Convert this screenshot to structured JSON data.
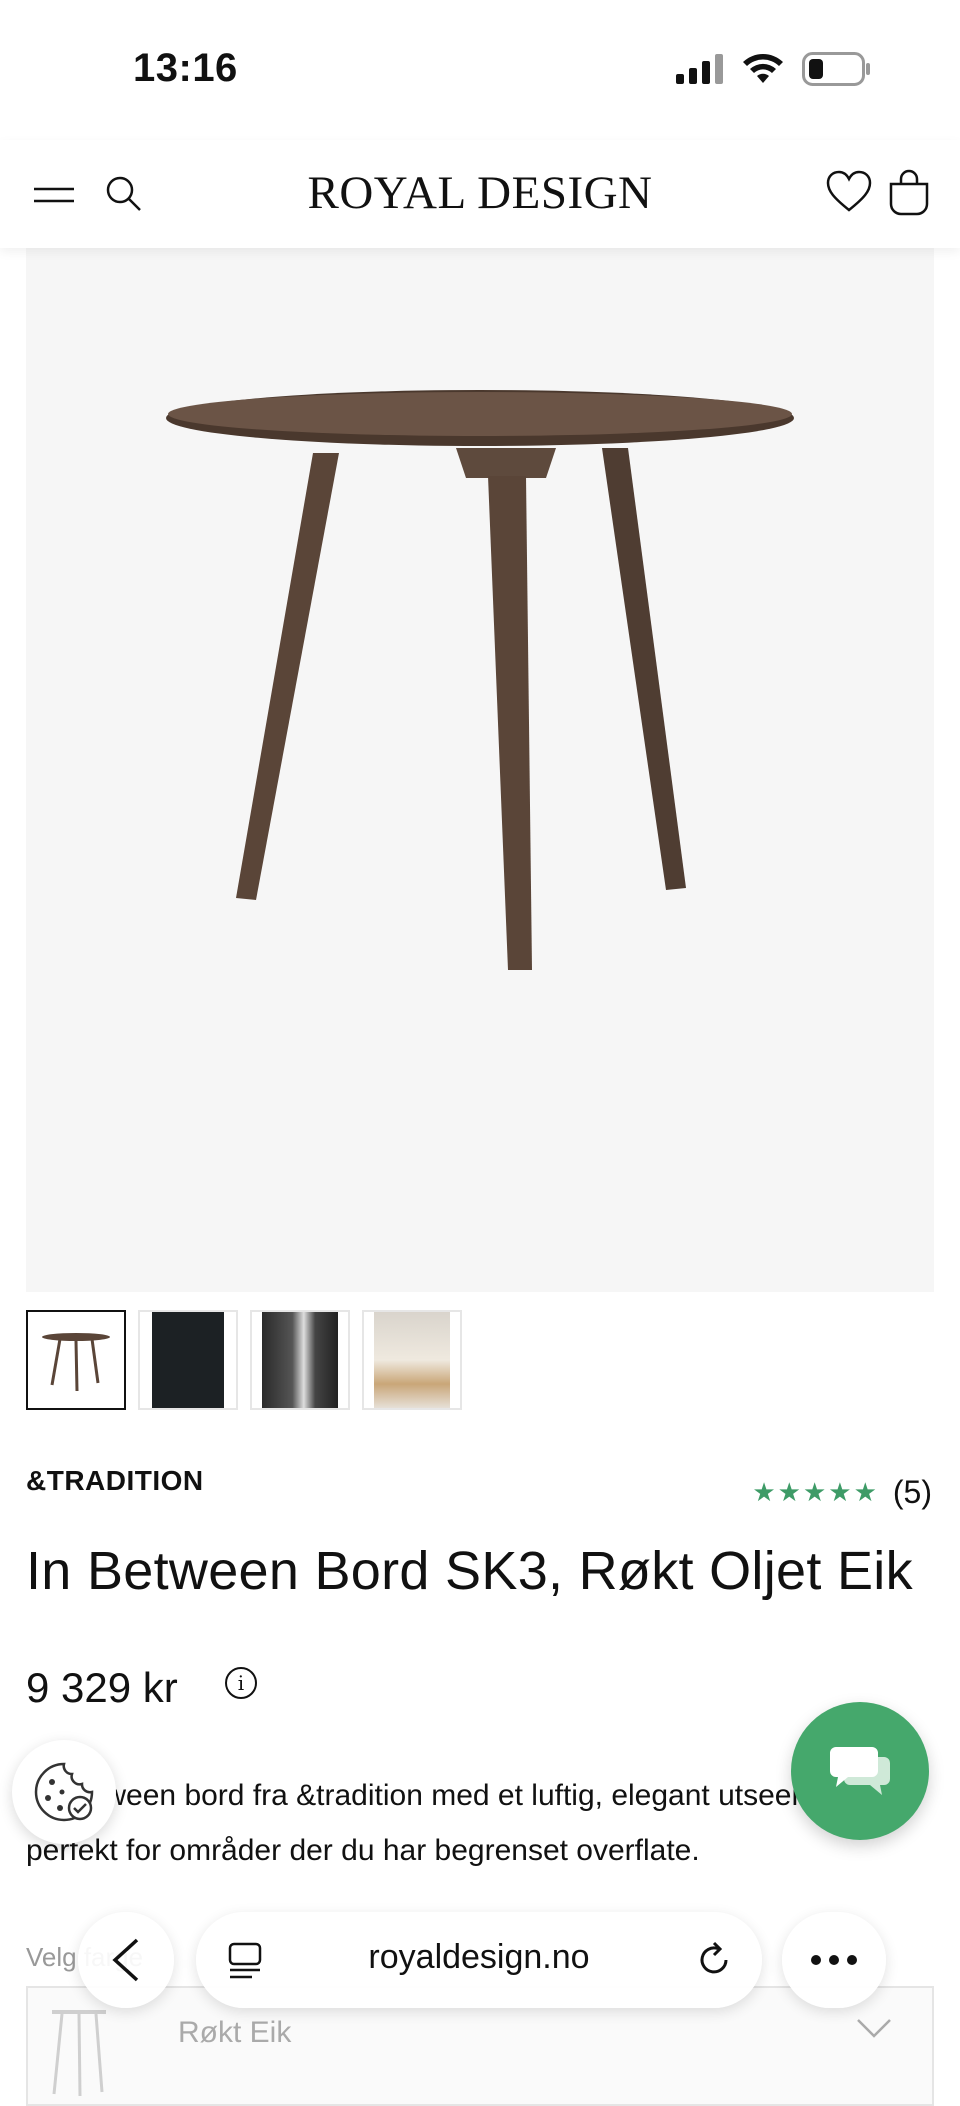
{
  "status_bar": {
    "time": "13:16"
  },
  "header": {
    "logo": "ROYAL DESIGN"
  },
  "product": {
    "brand": "&TRADITION",
    "rating_stars": "★★★★★",
    "rating_count": "(5)",
    "rating_value": 5,
    "title": "In Between Bord SK3, Røkt Oljet Eik",
    "price": "9 329 kr",
    "description": "In Between bord fra &tradition med et luftig, elegant utseende perfekt for områder der du har begrenset overflate.",
    "thumbnails": [
      {
        "name": "thumb-table"
      },
      {
        "name": "thumb-dark"
      },
      {
        "name": "thumb-room"
      },
      {
        "name": "thumb-dining"
      }
    ]
  },
  "variant": {
    "label": "Velg farge",
    "value": "Røkt Eik"
  },
  "browser": {
    "url": "royaldesign.no"
  },
  "colors": {
    "star_green": "#3e9b67",
    "chat_green": "#45a86c",
    "wood": "#5a4538"
  }
}
